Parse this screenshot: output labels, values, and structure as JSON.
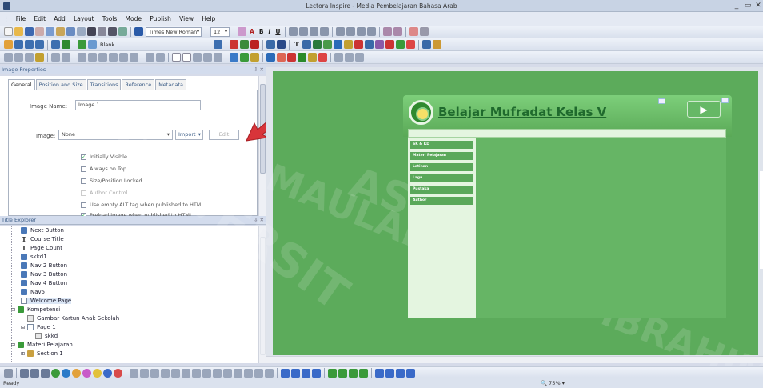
{
  "window": {
    "title": "Lectora Inspire - Media Pembelajaran Bahasa Arab",
    "controls": [
      "_",
      "▭",
      "✕"
    ]
  },
  "menu": [
    "File",
    "Edit",
    "Add",
    "Layout",
    "Tools",
    "Mode",
    "Publish",
    "View",
    "Help"
  ],
  "toolbar": {
    "font": "Times New Roman",
    "font_size": "12",
    "style_name": "Blank",
    "bold": "B",
    "italic": "I",
    "underline": "U",
    "font_color": "A"
  },
  "properties_panel": {
    "title": "Image Properties",
    "tabs": [
      "General",
      "Position and Size",
      "Transitions",
      "Reference",
      "Metadata"
    ],
    "image_name_label": "Image Name:",
    "image_name_value": "Image 1",
    "image_label": "Image:",
    "image_select": "None",
    "import_button": "Import",
    "edit_button": "Edit",
    "options": [
      {
        "label": "Initially Visible",
        "checked": true,
        "disabled": false
      },
      {
        "label": "Always on Top",
        "checked": false,
        "disabled": false
      },
      {
        "label": "Size/Position Locked",
        "checked": false,
        "disabled": false
      },
      {
        "label": "Author Control",
        "checked": false,
        "disabled": true
      },
      {
        "label": "Use empty ALT tag when published to HTML",
        "checked": false,
        "disabled": false
      },
      {
        "label": "Preload image when published to HTML",
        "checked": true,
        "disabled": false
      }
    ]
  },
  "explorer": {
    "title": "Title Explorer",
    "items": [
      {
        "label": "Next Button",
        "icon": "button-icon"
      },
      {
        "label": "Course Title",
        "icon": "text-icon"
      },
      {
        "label": "Page Count",
        "icon": "text-icon"
      },
      {
        "label": "skkd1",
        "icon": "button-icon"
      },
      {
        "label": "Nav 2 Button",
        "icon": "button-icon"
      },
      {
        "label": "Nav 3 Button",
        "icon": "button-icon"
      },
      {
        "label": "Nav 4 Button",
        "icon": "button-icon"
      },
      {
        "label": "Nav5",
        "icon": "button-icon"
      },
      {
        "label": "Welcome Page",
        "icon": "page-icon"
      },
      {
        "label": "Kompetensi",
        "icon": "chapter-icon"
      },
      {
        "label": "Gambar Kartun Anak Sekolah",
        "icon": "image-icon"
      },
      {
        "label": "Page 1",
        "icon": "page-icon"
      },
      {
        "label": "skkd",
        "icon": "image-icon"
      },
      {
        "label": "Materi Pelajaran",
        "icon": "chapter-icon"
      },
      {
        "label": "Section 1",
        "icon": "section-icon"
      }
    ]
  },
  "slide": {
    "title": "Belajar Mufradat Kelas V",
    "play": "▶",
    "nav": [
      "SK & KD",
      "Materi Pelajaran",
      "Latihan",
      "Lagu",
      "Pustaka",
      "Author"
    ]
  },
  "watermark": [
    "AS ISLAM",
    "UNIVERSIT",
    "MAULANA MALIK IBRAHIM"
  ],
  "status": {
    "text": "Ready",
    "zoom": "75%"
  },
  "colors": {
    "canvas": "#5cab5b",
    "slide_title": "#1f6a2d",
    "panel_header": "#3b5c86"
  }
}
